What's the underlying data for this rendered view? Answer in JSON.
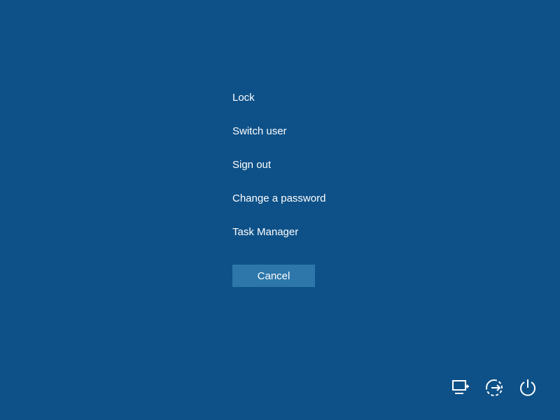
{
  "menu": {
    "items": [
      {
        "label": "Lock"
      },
      {
        "label": "Switch user"
      },
      {
        "label": "Sign out"
      },
      {
        "label": "Change a password"
      },
      {
        "label": "Task Manager"
      }
    ]
  },
  "cancel": {
    "label": "Cancel"
  },
  "tray": {
    "icons": [
      {
        "name": "network-icon"
      },
      {
        "name": "ease-of-access-icon"
      },
      {
        "name": "power-icon"
      }
    ]
  },
  "colors": {
    "background": "#0e5188",
    "button": "#2d77aa",
    "text": "#ffffff"
  }
}
